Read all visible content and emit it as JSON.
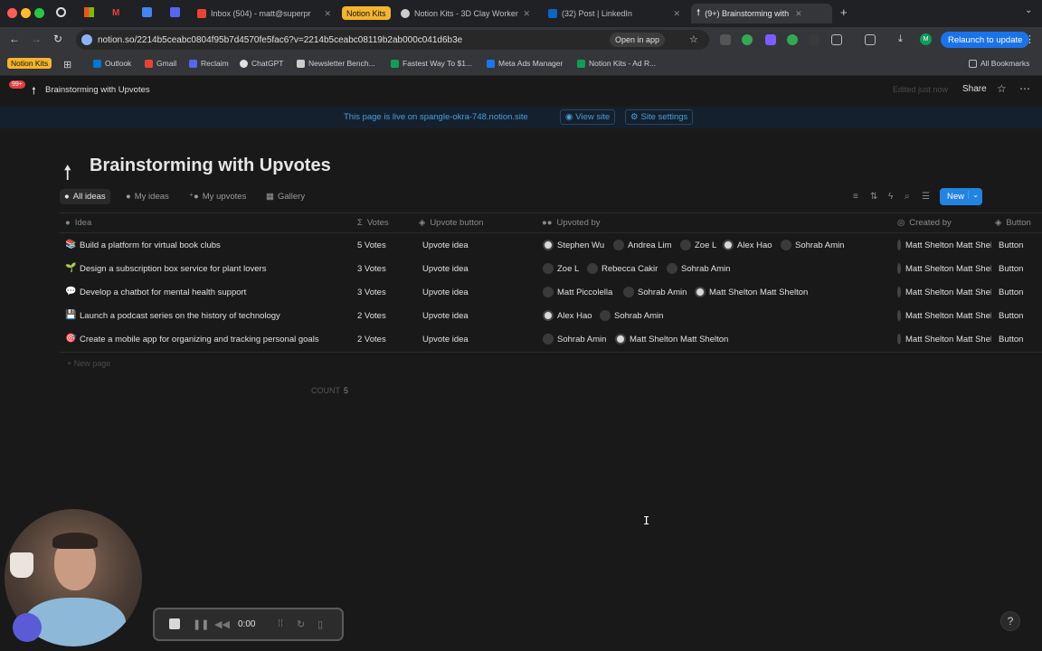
{
  "browser": {
    "tabs": [
      {
        "label": "Inbox (504) - matt@superpr",
        "favicon_color": "#ea4335"
      },
      {
        "label": "Notion Kits",
        "is_group": true
      },
      {
        "label": "Notion Kits - 3D Clay Worker",
        "favicon_color": "#cccccc"
      },
      {
        "label": "(32) Post | LinkedIn",
        "favicon_color": "#0a66c2"
      },
      {
        "label": "(9+) Brainstorming with",
        "favicon_color": "#e8e8e8",
        "active": true
      }
    ],
    "url": "notion.so/2214b5ceabc0804f95b7d4570fe5fac6?v=2214b5ceabc08119b2ab000c041d6b3e",
    "open_in_app": "Open in app",
    "relaunch": "Relaunch to update",
    "bookmarks": [
      {
        "label": "Notion Kits",
        "badge": true
      },
      {
        "label": "Outlook",
        "color": "#0078d4"
      },
      {
        "label": "Gmail",
        "color": "#ea4335"
      },
      {
        "label": "Reclaim",
        "color": "#5865f2"
      },
      {
        "label": "ChatGPT",
        "color": "#e0e0e0"
      },
      {
        "label": "Newsletter Bench...",
        "color": "#cccccc"
      },
      {
        "label": "Fastest Way To $1...",
        "color": "#0f9d58"
      },
      {
        "label": "Meta Ads Manager",
        "color": "#1877f2"
      },
      {
        "label": "Notion Kits - Ad R...",
        "color": "#0f9d58"
      }
    ],
    "all_bookmarks": "All Bookmarks"
  },
  "notion": {
    "breadcrumb": "Brainstorming with Upvotes",
    "notif_badge": "99+",
    "edited": "Edited just now",
    "share": "Share",
    "banner": {
      "text": "This page is live on spangle-okra-748.notion.site",
      "view_site": "View site",
      "site_settings": "Site settings"
    },
    "title": "Brainstorming with Upvotes",
    "views": [
      "All ideas",
      "My ideas",
      "My upvotes",
      "Gallery"
    ],
    "new_button": "New",
    "columns": {
      "idea": "Idea",
      "votes": "Votes",
      "upvote_button": "Upvote button",
      "upvoted_by": "Upvoted by",
      "created_by": "Created by",
      "button": "Button"
    },
    "rows": [
      {
        "emoji": "📚",
        "idea": "Build a platform for virtual book clubs",
        "votes": "5 Votes",
        "upvote": "Upvote idea",
        "voters": [
          "Stephen Wu",
          "Andrea Lim",
          "Zoe L",
          "Alex Hao",
          "Sohrab Amin"
        ],
        "creator": "Matt Shelton Matt Shelton",
        "button": "Button"
      },
      {
        "emoji": "🌱",
        "idea": "Design a subscription box service for plant lovers",
        "votes": "3 Votes",
        "upvote": "Upvote idea",
        "voters": [
          "Zoe L",
          "Rebecca Cakir",
          "Sohrab Amin"
        ],
        "creator": "Matt Shelton Matt Shelton",
        "button": "Button"
      },
      {
        "emoji": "💬",
        "idea": "Develop a chatbot for mental health support",
        "votes": "3 Votes",
        "upvote": "Upvote idea",
        "voters": [
          "Matt Piccolella",
          "Sohrab Amin",
          "Matt Shelton Matt Shelton"
        ],
        "creator": "Matt Shelton Matt Shelton",
        "button": "Button"
      },
      {
        "emoji": "💾",
        "idea": "Launch a podcast series on the history of technology",
        "votes": "2 Votes",
        "upvote": "Upvote idea",
        "voters": [
          "Alex Hao",
          "Sohrab Amin"
        ],
        "creator": "Matt Shelton Matt Shelton",
        "button": "Button"
      },
      {
        "emoji": "🎯",
        "idea": "Create a mobile app for organizing and tracking personal goals",
        "votes": "2 Votes",
        "upvote": "Upvote idea",
        "voters": [
          "Sohrab Amin",
          "Matt Shelton Matt Shelton"
        ],
        "creator": "Matt Shelton Matt Shelton",
        "button": "Button"
      }
    ],
    "new_page": "New page",
    "count_label": "COUNT",
    "count_value": "5"
  },
  "recorder": {
    "time": "0:00"
  }
}
